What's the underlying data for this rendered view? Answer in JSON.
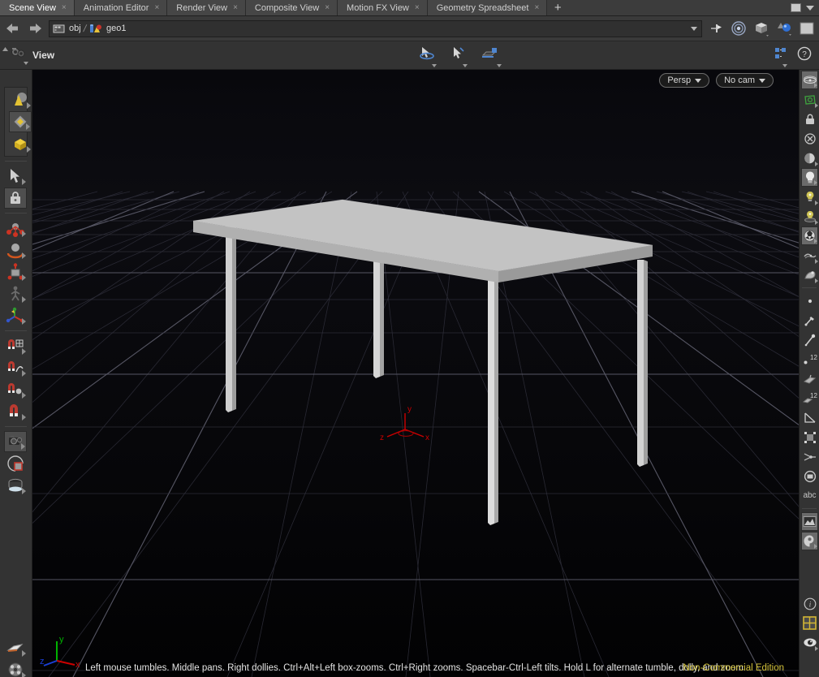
{
  "window": {
    "app": "Houdini Scene View",
    "edition_notice": "Non-Commercial Edition"
  },
  "tabbar": {
    "tabs": [
      {
        "label": "Scene View",
        "active": true,
        "close": "×"
      },
      {
        "label": "Animation Editor",
        "active": false,
        "close": "×"
      },
      {
        "label": "Render View",
        "active": false,
        "close": "×"
      },
      {
        "label": "Composite View",
        "active": false,
        "close": "×"
      },
      {
        "label": "Motion FX View",
        "active": false,
        "close": "×"
      },
      {
        "label": "Geometry Spreadsheet",
        "active": false,
        "close": "×"
      }
    ],
    "add_label": "+",
    "add_icon": "plus-icon",
    "maximize_icon": "maximize-box-icon",
    "menu_icon": "chevron-down-icon"
  },
  "pathbar": {
    "back_icon": "back-arrow-icon",
    "forward_icon": "forward-arrow-icon",
    "crumbs": [
      {
        "label": "obj",
        "icon": "network-obj-icon"
      },
      {
        "label": "geo1",
        "icon": "geometry-node-icon"
      }
    ],
    "separator": "›",
    "dropdown_icon": "chevron-down-icon",
    "right_icons": [
      "pin-icon",
      "target-icon",
      "box-display-icon",
      "lighting-display-icon",
      "flat-shade-icon"
    ]
  },
  "viewbar": {
    "menu_icon": "view-camera-icon",
    "label": "View",
    "center_icons": [
      "select-tumble-icon",
      "select-arrow-icon",
      "handle-icon"
    ],
    "right_icons": [
      "display-options-icon",
      "help-icon"
    ]
  },
  "left_toolbar": {
    "groups": [
      {
        "boxed": true,
        "items": [
          {
            "name": "view-shading-icon",
            "active": false,
            "arrow": true
          },
          {
            "name": "select-mode-icon",
            "active": true,
            "arrow": true
          },
          {
            "name": "transform-box-icon",
            "active": false,
            "arrow": true
          }
        ]
      },
      {
        "boxed": false,
        "items": [
          {
            "name": "select-arrow-icon",
            "active": false,
            "arrow": true
          },
          {
            "name": "handle-lock-icon",
            "active": true,
            "arrow": false
          }
        ]
      },
      {
        "boxed": false,
        "items": [
          {
            "name": "move-tool-icon",
            "active": false,
            "arrow": true
          },
          {
            "name": "rotate-tool-icon",
            "active": false,
            "arrow": true
          },
          {
            "name": "scale-tool-icon",
            "active": false,
            "arrow": true
          },
          {
            "name": "pose-tool-icon",
            "active": false,
            "arrow": true
          },
          {
            "name": "transform-axis-icon",
            "active": false,
            "arrow": true
          }
        ]
      },
      {
        "boxed": false,
        "items": [
          {
            "name": "snap-grid-icon",
            "active": false,
            "arrow": true
          },
          {
            "name": "snap-primitive-icon",
            "active": false,
            "arrow": true
          },
          {
            "name": "snap-point-icon",
            "active": false,
            "arrow": true
          },
          {
            "name": "snap-multi-icon",
            "active": false,
            "arrow": true
          }
        ]
      },
      {
        "boxed": false,
        "items": [
          {
            "name": "camera-tool-icon",
            "active": true,
            "arrow": true
          },
          {
            "name": "viewport-region-icon",
            "active": false,
            "arrow": false
          },
          {
            "name": "lens-tool-icon",
            "active": false,
            "arrow": true
          }
        ]
      },
      {
        "boxed": false,
        "items": [
          {
            "name": "material-palette-icon",
            "active": false,
            "arrow": true
          },
          {
            "name": "render-film-icon",
            "active": false,
            "arrow": true
          }
        ]
      }
    ]
  },
  "right_toolbar": {
    "items": [
      {
        "name": "ghost-display-icon",
        "active": true,
        "arrow": true
      },
      {
        "name": "wire-shaded-icon",
        "active": false,
        "arrow": true
      },
      {
        "name": "lock-display-icon",
        "active": false,
        "arrow": false
      },
      {
        "name": "no-display-icon",
        "active": false,
        "arrow": false
      },
      {
        "name": "half-shade-icon",
        "active": false,
        "arrow": true
      },
      {
        "name": "headlight-icon",
        "active": true,
        "arrow": true
      },
      {
        "name": "light-bulb-off-icon",
        "active": false,
        "arrow": true
      },
      {
        "name": "point-light-icon",
        "active": false,
        "arrow": true
      },
      {
        "name": "environment-map-icon",
        "active": true,
        "arrow": true
      },
      {
        "name": "show-normals-icon",
        "active": false,
        "arrow": true
      },
      {
        "name": "texture-paint-icon",
        "active": false,
        "arrow": true
      },
      {
        "name": "display-point-icon",
        "active": false,
        "arrow": false
      },
      {
        "name": "point-marker-icon",
        "active": false,
        "arrow": false
      },
      {
        "name": "point-normals-icon",
        "active": false,
        "arrow": false
      },
      {
        "name": "point-numbers-icon",
        "active": false,
        "arrow": false,
        "badge": "12"
      },
      {
        "name": "primitive-display-icon",
        "active": false,
        "arrow": false
      },
      {
        "name": "primitive-numbers-icon",
        "active": false,
        "arrow": false,
        "badge": "12"
      },
      {
        "name": "show-angle-icon",
        "active": false,
        "arrow": false
      },
      {
        "name": "show-hull-icon",
        "active": false,
        "arrow": false
      },
      {
        "name": "show-vectors-icon",
        "active": false,
        "arrow": false
      },
      {
        "name": "show-profile-icon",
        "active": false,
        "arrow": false
      },
      {
        "name": "show-text-icon",
        "active": false,
        "arrow": false,
        "label": "abc"
      },
      {
        "name": "background-image-icon",
        "active": true,
        "arrow": false
      },
      {
        "name": "scene-marker-icon",
        "active": true,
        "arrow": true
      },
      {
        "name": "info-icon",
        "active": false,
        "arrow": false
      },
      {
        "name": "layout-grid-icon",
        "active": false,
        "arrow": false
      },
      {
        "name": "eye-visibility-icon",
        "active": false,
        "arrow": true
      }
    ]
  },
  "viewport": {
    "camera_pill": {
      "label": "Persp",
      "caret_icon": "chevron-down-icon"
    },
    "cam_pill": {
      "label": "No cam",
      "caret_icon": "chevron-down-icon"
    },
    "status_text": "Left mouse tumbles. Middle pans. Right dollies. Ctrl+Alt+Left box-zooms. Ctrl+Right zooms. Spacebar-Ctrl-Left tilts. Hold L for alternate tumble, dolly, and zoom.",
    "origin_gizmo": {
      "x": "x",
      "y": "y",
      "z": "z",
      "color": "#cc0000"
    },
    "axis_widget": {
      "x": "x",
      "y": "y",
      "z": "z",
      "x_color": "#cc0000",
      "y_color": "#00b200",
      "z_color": "#1a3fd6"
    },
    "scene_object": "rectangular-table",
    "grid_color": "#2a2a33",
    "background": "#000000"
  }
}
